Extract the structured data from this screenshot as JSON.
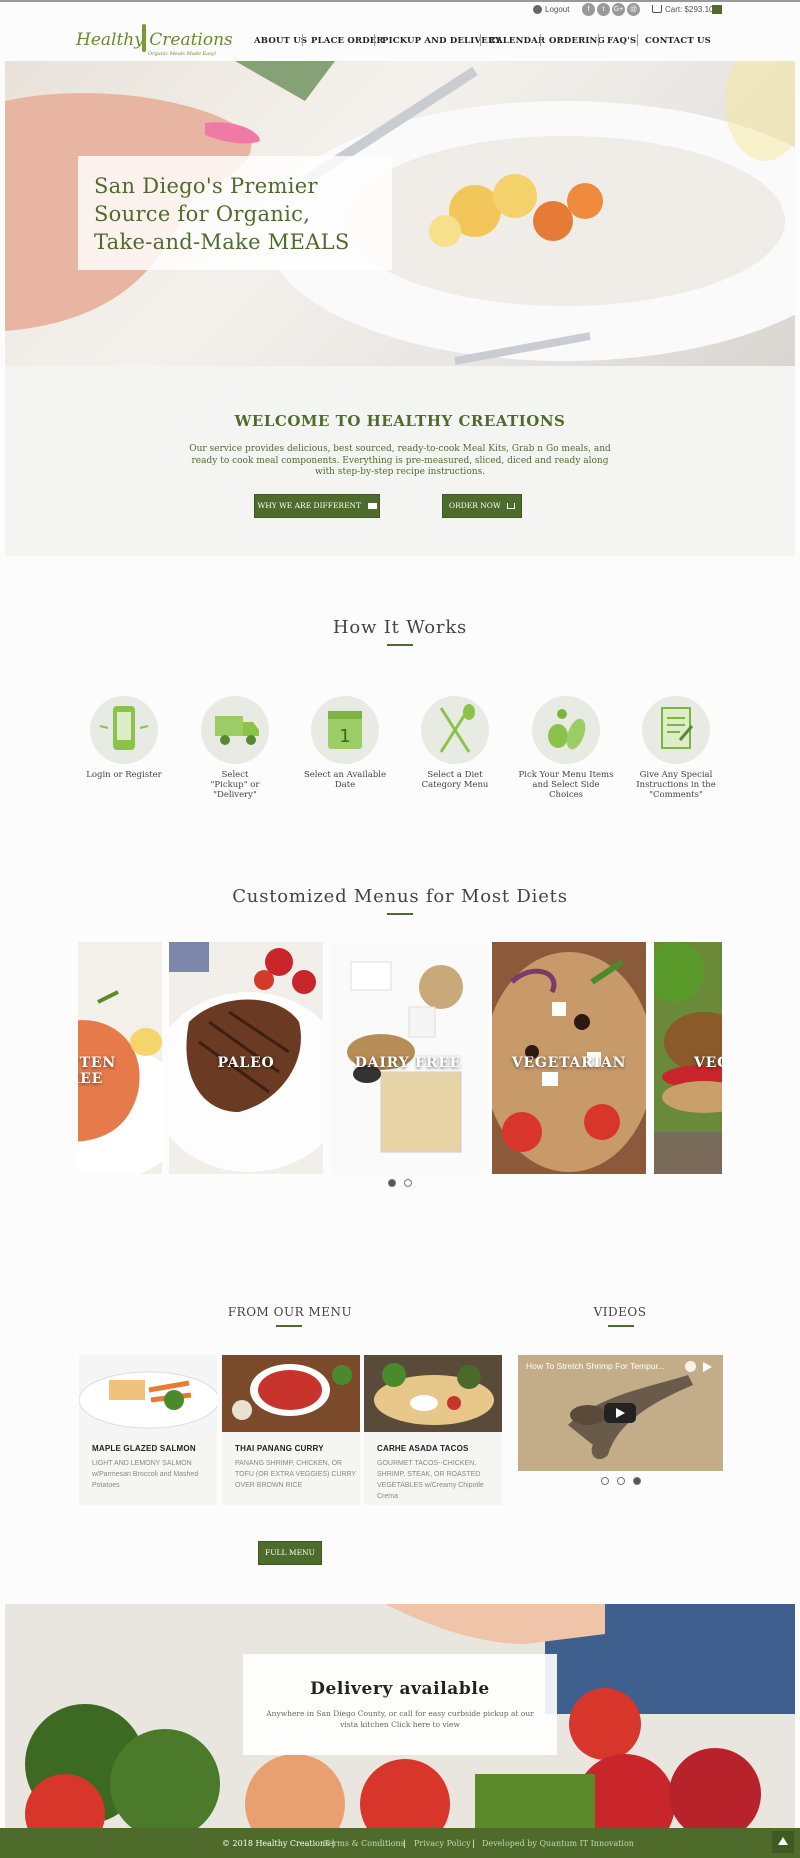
{
  "header": {
    "logout": "Logout",
    "social": [
      "f",
      "t",
      "G+",
      "@"
    ],
    "cart": "Cart: $293.10",
    "logo_main": "Healthy Creations",
    "logo_tag": "Organic Meals Made Easy!",
    "nav": [
      "ABOUT US",
      "PLACE ORDER",
      "PICKUP AND DELIVERY",
      "CALENDAR",
      "ORDERING",
      "FAQ'S",
      "CONTACT US"
    ]
  },
  "hero": {
    "line1": "San Diego's Premier",
    "line2": "Source for Organic,",
    "line3": "Take-and-Make MEALS"
  },
  "welcome": {
    "title": "WELCOME TO HEALTHY CREATIONS",
    "body": "Our service provides delicious, best sourced, ready-to-cook Meal Kits, Grab n Go meals, and ready to cook meal components. Everything is pre-measured, sliced, diced and ready along with step-by-step recipe instructions.",
    "btn_different": "WHY WE ARE DIFFERENT",
    "btn_order": "ORDER NOW"
  },
  "how": {
    "title": "How It Works",
    "steps": [
      {
        "label": "Login or Register",
        "icon": "phone-icon"
      },
      {
        "label": "Select \"Pickup\" or \"Delivery\"",
        "icon": "truck-icon"
      },
      {
        "label": "Select an Available Date",
        "icon": "calendar-icon"
      },
      {
        "label": "Select a Diet Category Menu",
        "icon": "fork-spoon-icon"
      },
      {
        "label": "Pick Your Menu Items and Select Side Choices",
        "icon": "vegetables-icon"
      },
      {
        "label": "Give Any Special Instructions in the \"Comments\"",
        "icon": "document-icon"
      }
    ]
  },
  "diets": {
    "title": "Customized Menus for Most Diets",
    "cards": [
      "GLUTEN FREE",
      "PALEO",
      "DAIRY FREE",
      "VEGETARIAN",
      "VEGAN"
    ]
  },
  "from_menu": {
    "title": "FROM OUR MENU",
    "items": [
      {
        "title": "MAPLE GLAZED SALMON",
        "desc": "LIGHT AND LEMONY SALMON w/Parmesan Broccoli and Mashed Potatoes"
      },
      {
        "title": "THAI PANANG CURRY",
        "desc": "PANANG SHRIMP, CHICKEN, OR TOFU (OR EXTRA VEGGIES) CURRY OVER BROWN RICE"
      },
      {
        "title": "CARHE ASADA TACOS",
        "desc": "GOURMET TACOS--CHICKEN, SHRIMP, STEAK, OR ROASTED VEGETABLES w/Creamy Chipotle Crema"
      }
    ],
    "btn_full": "FULL MENU"
  },
  "videos": {
    "title": "VIDEOS",
    "video_title": "How To Stretch Shrimp For Tempur..."
  },
  "delivery": {
    "title": "Delivery available",
    "body": "Anywhere in San Diego County, or call for easy curbside pickup at our vista kitchen Click here to view"
  },
  "footer": {
    "copyright": "© 2018 Healthy Creations |",
    "terms": "Terms & Conditions",
    "privacy": "Privacy Policy",
    "developed": "Developed by Quantum IT Innovation"
  }
}
